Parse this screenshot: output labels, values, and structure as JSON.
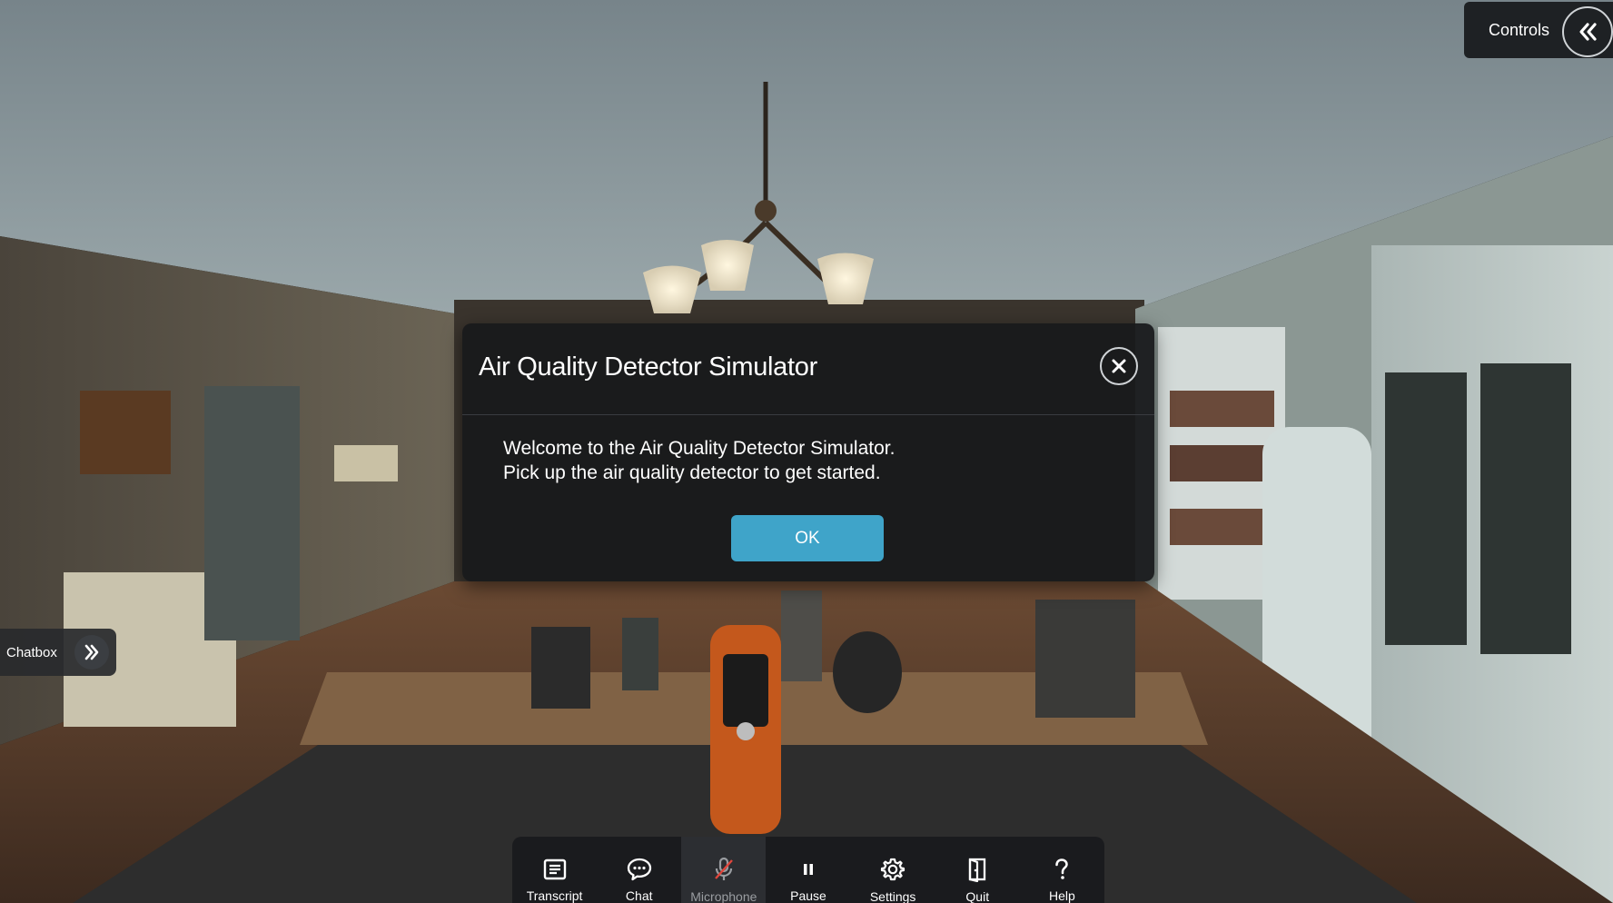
{
  "controls": {
    "label": "Controls"
  },
  "chatbox": {
    "label": "Chatbox"
  },
  "dialog": {
    "title": "Air Quality Detector Simulator",
    "line1": "Welcome to the Air Quality Detector Simulator.",
    "line2": "Pick up the air quality detector to get started.",
    "ok_label": "OK"
  },
  "toolbar": {
    "items": [
      {
        "label": "Transcript",
        "icon": "transcript-icon"
      },
      {
        "label": "Chat",
        "icon": "chat-icon"
      },
      {
        "label": "Microphone",
        "icon": "microphone-icon",
        "state": "disabled"
      },
      {
        "label": "Pause",
        "icon": "pause-icon"
      },
      {
        "label": "Settings",
        "icon": "gear-icon"
      },
      {
        "label": "Quit",
        "icon": "quit-icon"
      },
      {
        "label": "Help",
        "icon": "help-icon"
      }
    ]
  },
  "colors": {
    "accent": "#3fa4c9",
    "panel": "#18191c"
  }
}
